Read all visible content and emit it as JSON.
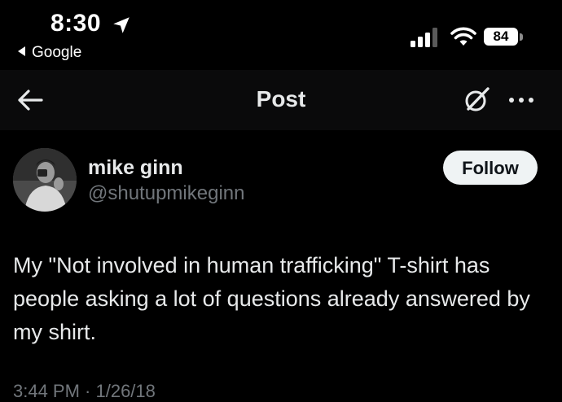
{
  "status_bar": {
    "time": "8:30",
    "back_app_label": "Google",
    "battery_level": "84"
  },
  "header": {
    "title": "Post"
  },
  "post": {
    "author_name": "mike ginn",
    "author_handle": "@shutupmikeginn",
    "follow_label": "Follow",
    "text": "My \"Not involved in human trafficking\" T-shirt has people asking a lot of questions already answered by my shirt.",
    "timestamp": "3:44 PM · 1/26/18"
  },
  "icons": [
    "location-arrow-icon",
    "signal-icon",
    "wifi-icon",
    "battery-icon",
    "back-arrow-icon",
    "grok-icon",
    "more-icon"
  ],
  "colors": {
    "background": "#000000",
    "header_background": "#0a0a0b",
    "primary_text": "#e7e9ea",
    "secondary_text": "#71767b",
    "follow_button": "#eff3f4"
  }
}
